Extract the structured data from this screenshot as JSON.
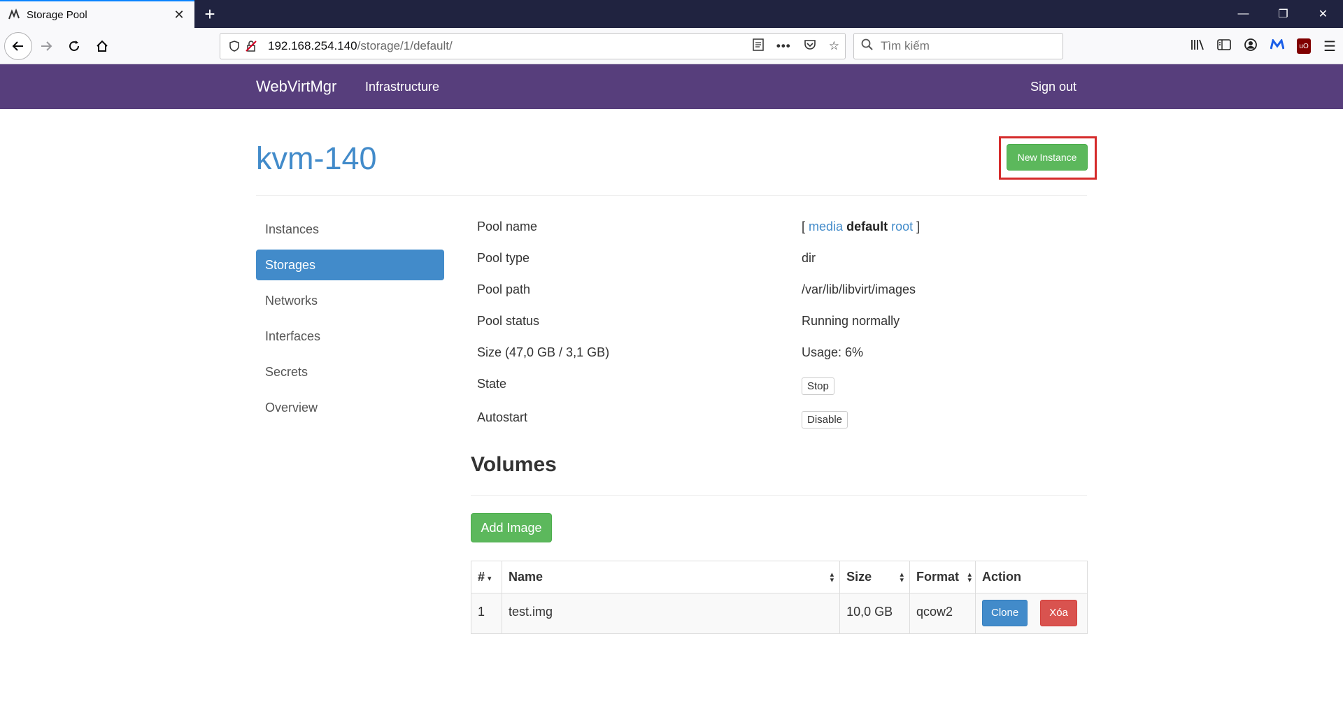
{
  "browser": {
    "tab_title": "Storage Pool",
    "url_host": "192.168.254.140",
    "url_path": "/storage/1/default/",
    "search_placeholder": "Tìm kiếm"
  },
  "navbar": {
    "brand": "WebVirtMgr",
    "link_infrastructure": "Infrastructure",
    "sign_out": "Sign out"
  },
  "page": {
    "title": "kvm-140",
    "new_instance_label": "New Instance"
  },
  "sidebar": {
    "items": [
      {
        "label": "Instances",
        "active": false
      },
      {
        "label": "Storages",
        "active": true
      },
      {
        "label": "Networks",
        "active": false
      },
      {
        "label": "Interfaces",
        "active": false
      },
      {
        "label": "Secrets",
        "active": false
      },
      {
        "label": "Overview",
        "active": false
      }
    ]
  },
  "pool": {
    "name_label": "Pool name",
    "name_bracket_open": "[",
    "name_link_media": "media",
    "name_current": "default",
    "name_link_root": "root",
    "name_bracket_close": "]",
    "type_label": "Pool type",
    "type_value": "dir",
    "path_label": "Pool path",
    "path_value": "/var/lib/libvirt/images",
    "status_label": "Pool status",
    "status_value": "Running normally",
    "size_label": "Size (47,0 GB / 3,1 GB)",
    "usage_value": "Usage: 6%",
    "state_label": "State",
    "state_button": "Stop",
    "autostart_label": "Autostart",
    "autostart_button": "Disable"
  },
  "volumes": {
    "title": "Volumes",
    "add_image_label": "Add Image",
    "columns": [
      "#",
      "Name",
      "Size",
      "Format",
      "Action"
    ],
    "rows": [
      {
        "num": "1",
        "name": "test.img",
        "size": "10,0 GB",
        "format": "qcow2",
        "clone_label": "Clone",
        "delete_label": "Xóa"
      }
    ]
  },
  "colors": {
    "navbar": "#573e7c",
    "primary": "#428bca",
    "success": "#5cb85c",
    "danger": "#d9534f",
    "highlight_frame": "#d52b2b"
  }
}
